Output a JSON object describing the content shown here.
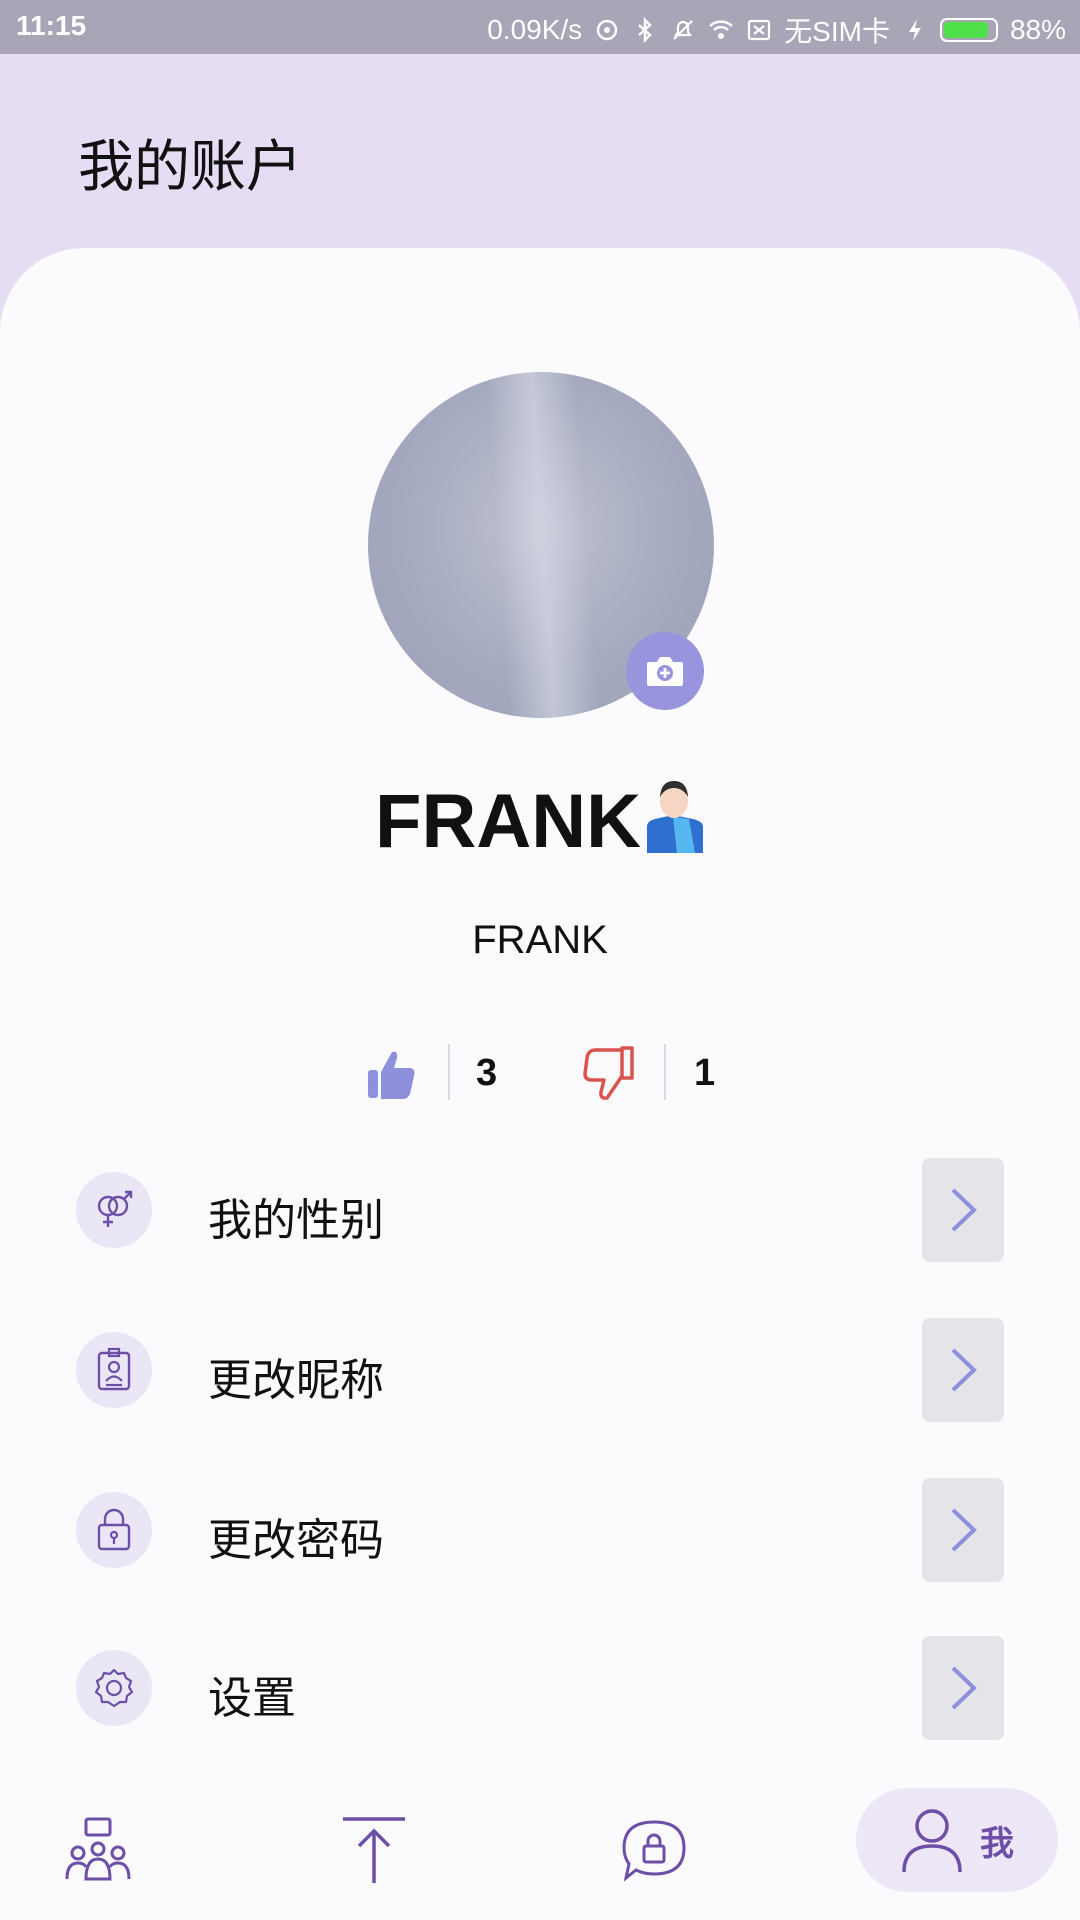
{
  "status_bar": {
    "time": "11:15",
    "net_speed": "0.09K/s",
    "sim": "无SIM卡",
    "battery_percent": "88%",
    "battery_level": 0.88
  },
  "header": {
    "title": "我的账户"
  },
  "profile": {
    "display_name": "FRANK",
    "username": "FRANK",
    "likes": "3",
    "dislikes": "1"
  },
  "menu": [
    {
      "label": "我的性别",
      "icon": "gender-icon"
    },
    {
      "label": "更改昵称",
      "icon": "badge-icon"
    },
    {
      "label": "更改密码",
      "icon": "lock-icon"
    },
    {
      "label": "设置",
      "icon": "gear-icon"
    }
  ],
  "tabbar": {
    "me_label": "我"
  },
  "colors": {
    "accent": "#6d4fa8",
    "accent_light": "#9894dd",
    "header_bg": "#e6dcf3",
    "dislike": "#d9534f"
  }
}
